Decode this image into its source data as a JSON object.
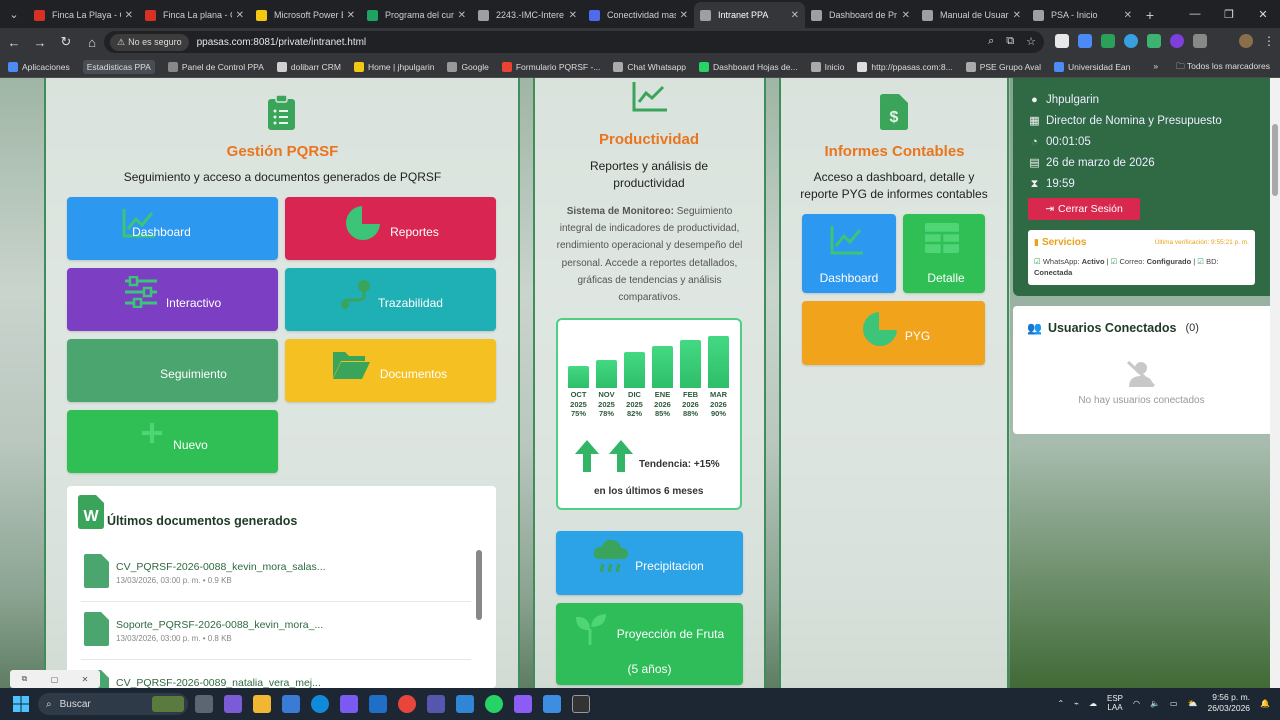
{
  "browser": {
    "tabs": [
      {
        "title": "Finca La Playa - G",
        "color": "#d93025"
      },
      {
        "title": "Finca La plana - G",
        "color": "#d93025"
      },
      {
        "title": "Microsoft Power B",
        "color": "#f2c811"
      },
      {
        "title": "Programa del curs",
        "color": "#1ea362"
      },
      {
        "title": "2243.-IMC-Intere",
        "color": "#9aa0a6"
      },
      {
        "title": "Conectividad mas",
        "color": "#4f6bed"
      },
      {
        "title": "Intranet PPA",
        "color": "#9aa0a6"
      },
      {
        "title": "Dashboard de Pr",
        "color": "#9aa0a6"
      },
      {
        "title": "Manual de Usuari",
        "color": "#9aa0a6"
      },
      {
        "title": "PSA - Inicio",
        "color": "#9aa0a6"
      }
    ],
    "active_tab_index": 6,
    "security_label": "No es seguro",
    "url": "ppasas.com:8081/private/intranet.html",
    "bookmarks": [
      "Aplicaciones",
      "Estadisticas PPA",
      "Panel de Control PPA",
      "dolibarr CRM",
      "Home | jhpulgarin",
      "Google",
      "Formulario PQRSF -...",
      "Chat Whatsapp",
      "Dashboard Hojas de...",
      "Inicio",
      "http://ppasas.com:8...",
      "PSE Grupo Aval",
      "Universidad Ean"
    ],
    "bookmarks_overflow": "»",
    "all_bookmarks": "Todos los marcadores"
  },
  "pqrsf": {
    "title": "Gestión PQRSF",
    "subtitle": "Seguimiento y acceso a documentos generados de PQRSF",
    "tiles": {
      "dashboard": "Dashboard",
      "reportes": "Reportes",
      "interactivo": "Interactivo",
      "trazabilidad": "Trazabilidad",
      "seguimiento": "Seguimiento",
      "documentos": "Documentos",
      "nuevo": "Nuevo"
    },
    "docs_title": "Últimos documentos generados",
    "docs": [
      {
        "name": "CV_PQRSF-2026-0088_kevin_mora_salas...",
        "meta": "13/03/2026, 03:00 p. m. • 0.9 KB"
      },
      {
        "name": "Soporte_PQRSF-2026-0088_kevin_mora_...",
        "meta": "13/03/2026, 03:00 p. m. • 0.8 KB"
      },
      {
        "name": "CV_PQRSF-2026-0089_natalia_vera_mej...",
        "meta": ""
      }
    ]
  },
  "productividad": {
    "title": "Productividad",
    "subtitle": "Reportes y análisis de productividad",
    "monitor_label": "Sistema de Monitoreo:",
    "monitor_text": "Seguimiento integral de indicadores de productividad, rendimiento operacional y desempeño del personal. Accede a reportes detallados, gráficas de tendencias y análisis comparativos.",
    "trend_label": "Tendencia: +15%",
    "trend_period": "en los últimos 6 meses",
    "precipitacion": "Precipitacion",
    "proyeccion": "Proyección de Fruta",
    "proyeccion_sub": "(5 años)"
  },
  "chart_data": {
    "type": "bar",
    "categories": [
      "OCT 2025",
      "NOV 2025",
      "DIC 2025",
      "ENE 2026",
      "FEB 2026",
      "MAR 2026"
    ],
    "series": [
      {
        "values": [
          75,
          78,
          82,
          85,
          88,
          90
        ]
      }
    ],
    "value_suffix": "%",
    "title": "",
    "xlabel": "",
    "ylabel": ""
  },
  "contables": {
    "title": "Informes Contables",
    "subtitle": "Acceso a dashboard, detalle y reporte PYG de informes contables",
    "tiles": {
      "dashboard": "Dashboard",
      "detalle": "Detalle",
      "pyg": "PYG"
    }
  },
  "user": {
    "name": "Jhpulgarin",
    "role": "Director de Nomina y Presupuesto",
    "timer": "00:01:05",
    "date": "26 de marzo de 2026",
    "time": "19:59",
    "logout": "Cerrar Sesión"
  },
  "services": {
    "title": "Servicios",
    "last_check": "Última verificación: 9:55:21 p. m.",
    "whatsapp_label": "WhatsApp:",
    "whatsapp_status": "Activo",
    "correo_label": "Correo:",
    "correo_status": "Configurado",
    "bd_label": "BD:",
    "bd_status": "Conectada"
  },
  "usuarios": {
    "title": "Usuarios Conectados",
    "count": "(0)",
    "empty": "No hay usuarios conectados"
  },
  "taskbar": {
    "search": "Buscar",
    "lang1": "ESP",
    "lang2": "LAA",
    "clock_time": "9:56 p. m.",
    "clock_date": "26/03/2026"
  }
}
